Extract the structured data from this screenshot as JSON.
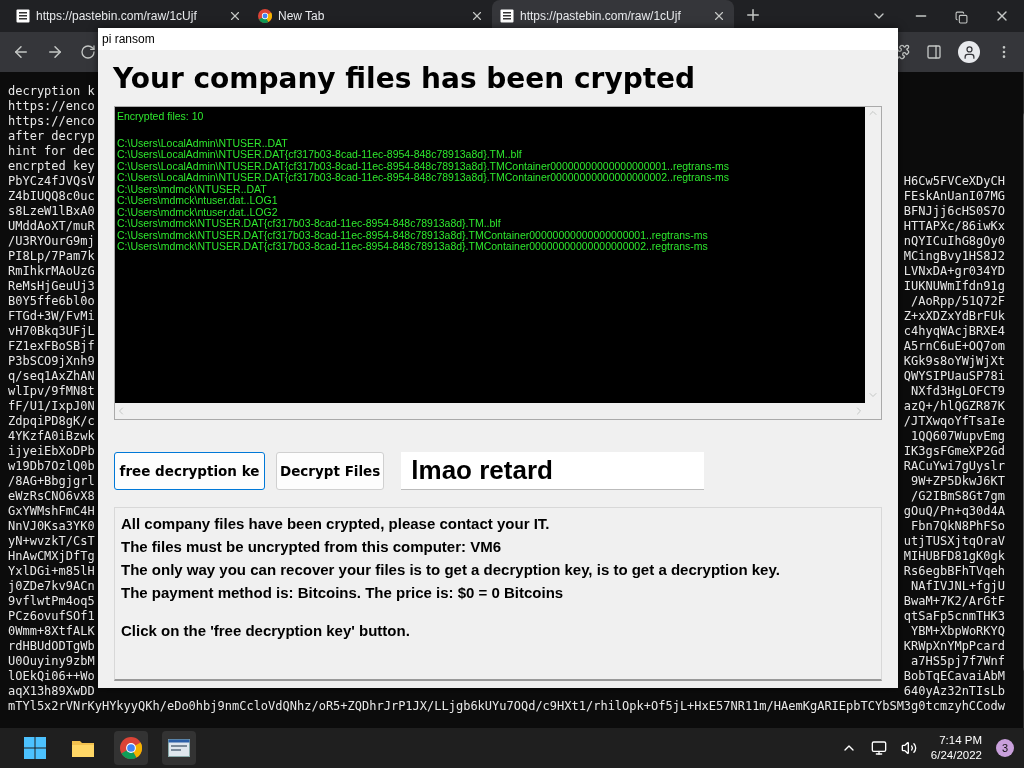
{
  "browser": {
    "tabs": [
      {
        "title": "https://pastebin.com/raw/1cUjf",
        "selected": false
      },
      {
        "title": "New Tab",
        "selected": false
      },
      {
        "title": "https://pastebin.com/raw/1cUjf",
        "selected": true
      }
    ]
  },
  "page": {
    "lines": [
      {
        "left": "decryption k"
      },
      {
        "left": "https://enco"
      },
      {
        "left": "https://enco"
      },
      {
        "left": "after decryp"
      },
      {
        "left": "hint for dec"
      },
      {
        "left": "encrpted key"
      },
      {
        "left": "PbYCz4fJVQsV",
        "right": "H6Cw5FVCeXDyCH"
      },
      {
        "left": "Z4bIUQQ8c0uc",
        "right": "FEskAnUanI07MG"
      },
      {
        "left": "s8LzeW1lBxA0",
        "right": "BFNJjj6cHS0S7O"
      },
      {
        "left": "UMddAoXT/muR",
        "right": "HTTAPXc/86iwKx"
      },
      {
        "left": "/U3RYOurG9mj",
        "right": "nQYICuIhG8gOy0"
      },
      {
        "left": "PI8Lp/7Pam7k",
        "right": "MCingBvy1HS8J2"
      },
      {
        "left": "RmIhkrMAoUzG",
        "right": "LVNxDA+gr034YD"
      },
      {
        "left": "ReMsHjGeuUj3",
        "right": "IUKNUWmIfdn91g"
      },
      {
        "left": "B0Y5ffe6bl0o",
        "right": "/AoRpp/51Q72F"
      },
      {
        "left": "FTGd+3W/FvMi",
        "right": "Z+xXDZxYdBrFUk"
      },
      {
        "left": "vH70Bkq3UFjL",
        "right": "c4hyqWAcjBRXE4"
      },
      {
        "left": "FZ1exFBoSBjf",
        "right": "A5rnC6uE+OQ7om"
      },
      {
        "left": "P3bSCO9jXnh9",
        "right": "KGk9s8oYWjWjXt"
      },
      {
        "left": "q/seq1AxZhAN",
        "right": "QWYSIPUauSP78i"
      },
      {
        "left": "wlIpv/9fMN8t",
        "right": "NXfd3HgLOFCT9"
      },
      {
        "left": "fF/U1/IxpJ0N",
        "right": "azQ+/hlQGZR87K"
      },
      {
        "left": "ZdpqiPD8gK/c",
        "right": "/JTXwqoYfTsaIe"
      },
      {
        "left": "4YKzfA0iBzwk",
        "right": "1QQ607WupvEmg"
      },
      {
        "left": "ijyeiEbXoDPb",
        "right": "IK3gsFGmeXP2Gd"
      },
      {
        "left": "w19Db7OzlQ0b",
        "right": "RACuYwi7gUyslr"
      },
      {
        "left": "/8AG+Bbgjgrl",
        "right": "9W+ZP5DkwJ6KT"
      },
      {
        "left": "eWzRsCNO6vX8",
        "right": "/G2IBmS8Gt7gm"
      },
      {
        "left": "GxYWMshFmC4H",
        "right": "gOuQ/Pn+q30d4A"
      },
      {
        "left": "NnVJ0Ksa3YK0",
        "right": "Fbn7QkN8PhFSo"
      },
      {
        "left": "yN+wvzkT/CsT",
        "right": "utjTUSXjtqOraV"
      },
      {
        "left": "HnAwCMXjDfTg",
        "right": "MIHUBFD81gK0gk"
      },
      {
        "left": "YxlDGi+m85lH",
        "right": "Rs6egbBFhTVqeh"
      },
      {
        "left": "j0ZDe7kv9ACn",
        "right": "NAfIVJNL+fgjU"
      },
      {
        "left": "9vflwtPm4oq5",
        "right": "BwaM+7K2/ArGtF"
      },
      {
        "left": "PCz6ovufSOf1",
        "right": "qtSaFp5cnmTHK3"
      },
      {
        "left": "0Wmm+8XtfALK",
        "right": "YBM+XbpWoRKYQ"
      },
      {
        "left": "rdHBUdODTgWb",
        "right": "KRWpXnYMpPcard"
      },
      {
        "left": "U0Ouyiny9zbM",
        "right": "a7HS5pj7f7Wnf"
      },
      {
        "left": "lOEkQi06++Wo",
        "right": "BobTqECavaiAbM"
      },
      {
        "left": "aqX13h89XwDD",
        "right": "640yAz32nTIsLb"
      }
    ],
    "wide_lines": [
      "mTYl5x2rVNrKyHYkyyQKh/eDo0hbj9nmCcloVdQNhz/oR5+ZQDhrJrP1JX/LLjgb6kUYu7OQd/c9HXt1/rhilOpk+Of5jL+HxE57NR11m/HAemKgARIEpbTCYbSM3g0tcmzyhCCodw"
    ]
  },
  "dialog": {
    "title": "pi ransom",
    "heading": "Your company files has been crypted",
    "file_list": {
      "summary": "Encrypted files: 10",
      "files": [
        "C:\\Users\\LocalAdmin\\NTUSER..DAT",
        "C:\\Users\\LocalAdmin\\NTUSER.DAT{cf317b03-8cad-11ec-8954-848c78913a8d}.TM..blf",
        "C:\\Users\\LocalAdmin\\NTUSER.DAT{cf317b03-8cad-11ec-8954-848c78913a8d}.TMContainer00000000000000000001..regtrans-ms",
        "C:\\Users\\LocalAdmin\\NTUSER.DAT{cf317b03-8cad-11ec-8954-848c78913a8d}.TMContainer00000000000000000002..regtrans-ms",
        "C:\\Users\\mdmck\\NTUSER..DAT",
        "C:\\Users\\mdmck\\ntuser.dat..LOG1",
        "C:\\Users\\mdmck\\ntuser.dat..LOG2",
        "C:\\Users\\mdmck\\NTUSER.DAT{cf317b03-8cad-11ec-8954-848c78913a8d}.TM..blf",
        "C:\\Users\\mdmck\\NTUSER.DAT{cf317b03-8cad-11ec-8954-848c78913a8d}.TMContainer00000000000000000001..regtrans-ms",
        "C:\\Users\\mdmck\\NTUSER.DAT{cf317b03-8cad-11ec-8954-848c78913a8d}.TMContainer00000000000000000002..regtrans-ms"
      ]
    },
    "buttons": [
      {
        "label": "free decryption ke",
        "focused": true
      },
      {
        "label": "Decrypt Files",
        "focused": false
      }
    ],
    "key_field": {
      "value": "lmao retard"
    },
    "message": {
      "lines": [
        "All company files have been crypted, please contact your IT.",
        "The files must be uncrypted from this computer: VM6",
        "The only way you can recover your files is to get a decryption key, is to get a decryption key.",
        "The payment method is: Bitcoins.  The price is: $0 = 0 Bitcoins"
      ],
      "footer": "Click on the 'free decryption key' button."
    }
  },
  "taskbar": {
    "time": "7:14 PM",
    "date": "6/24/2022",
    "notification_count": "3"
  }
}
